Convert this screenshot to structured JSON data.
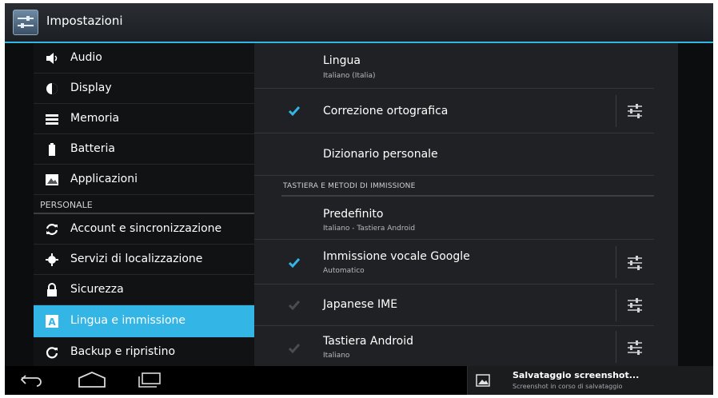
{
  "actionbar": {
    "title": "Impostazioni",
    "icon": "settings-sliders-icon"
  },
  "sidebar": {
    "items": [
      {
        "label": "Audio",
        "icon": "speaker-icon"
      },
      {
        "label": "Display",
        "icon": "brightness-icon"
      },
      {
        "label": "Memoria",
        "icon": "storage-icon"
      },
      {
        "label": "Batteria",
        "icon": "battery-icon"
      },
      {
        "label": "Applicazioni",
        "icon": "apps-icon"
      }
    ],
    "section_header": "PERSONALE",
    "personal_items": [
      {
        "label": "Account e sincronizzazione",
        "icon": "sync-icon"
      },
      {
        "label": "Servizi di localizzazione",
        "icon": "location-icon"
      },
      {
        "label": "Sicurezza",
        "icon": "lock-icon"
      },
      {
        "label": "Lingua e immissione",
        "icon": "language-icon",
        "selected": true
      },
      {
        "label": "Backup e ripristino",
        "icon": "backup-icon"
      }
    ]
  },
  "main": {
    "language": {
      "title": "Lingua",
      "subtitle": "Italiano (Italia)"
    },
    "spell_check": {
      "title": "Correzione ortografica",
      "checked": true
    },
    "personal_dictionary": {
      "title": "Dizionario personale"
    },
    "section_header": "TASTIERA E METODI DI IMMISSIONE",
    "default_ime": {
      "title": "Predefinito",
      "subtitle": "Italiano - Tastiera Android"
    },
    "google_voice": {
      "title": "Immissione vocale Google",
      "subtitle": "Automatico",
      "checked": true
    },
    "japanese_ime": {
      "title": "Japanese IME",
      "checked": true,
      "disabled": true
    },
    "android_keyboard": {
      "title": "Tastiera Android",
      "subtitle": "Italiano",
      "checked": true,
      "disabled": true
    }
  },
  "notification": {
    "title": "Salvataggio screenshot...",
    "subtitle": "Screenshot in corso di salvataggio",
    "icon": "image-icon"
  },
  "navbar": {
    "back_icon": "back-icon",
    "home_icon": "home-icon",
    "recents_icon": "recents-icon"
  },
  "colors": {
    "accent": "#33b5e5",
    "background": "#1f2124",
    "sidebar": "#111214",
    "checkmark": "#33b5e5",
    "checkmark_disabled": "#4a4d50"
  }
}
